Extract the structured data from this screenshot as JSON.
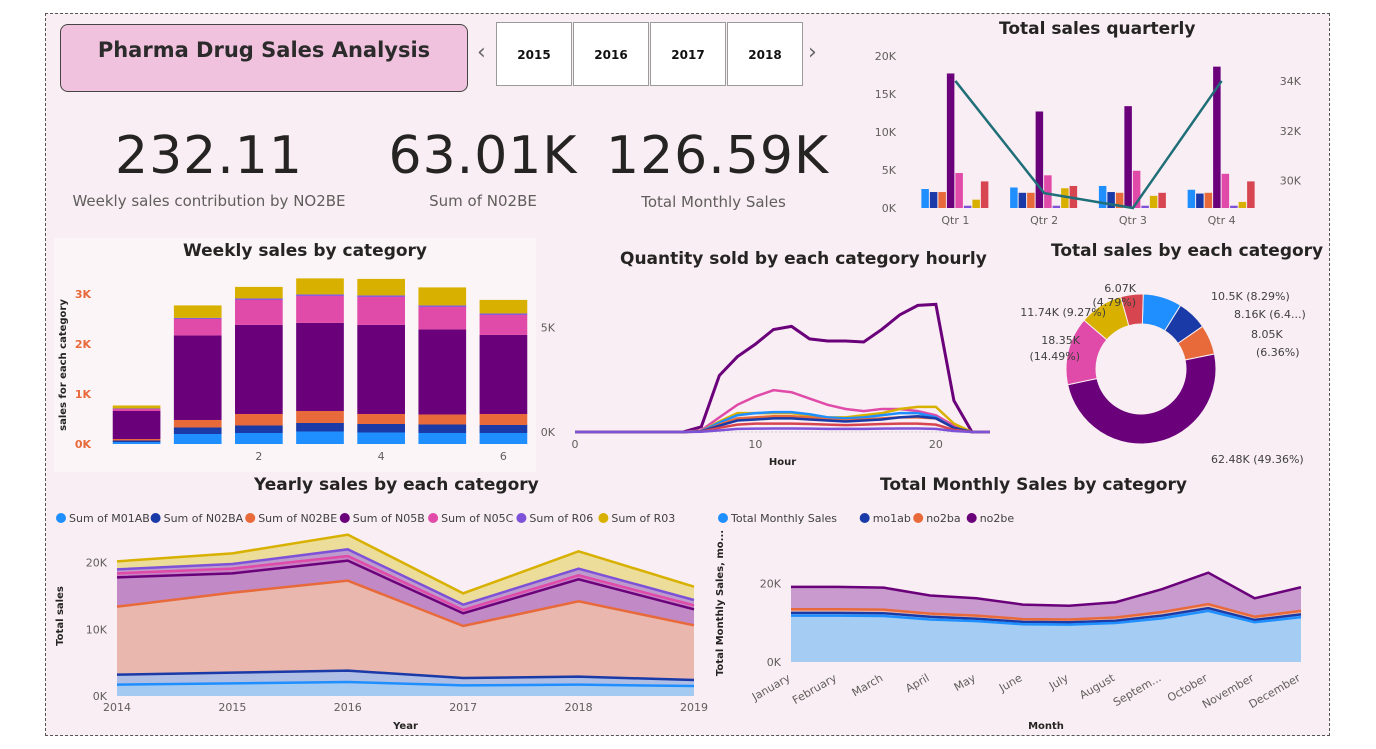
{
  "title": "Pharma Drug Sales Analysis",
  "slicer": {
    "years": [
      "2015",
      "2016",
      "2017",
      "2018"
    ],
    "prev": "‹",
    "next": "›"
  },
  "kpis": [
    {
      "value": "232.11",
      "label": "Weekly sales contribution by NO2BE"
    },
    {
      "value": "63.01K",
      "label": "Sum of N02BE"
    },
    {
      "value": "126.59K",
      "label": "Total Monthly Sales"
    }
  ],
  "colors": {
    "M01AB": "#1f8fff",
    "M01AE": "#1a3aa8",
    "N02BA": "#e86a3a",
    "N02BE": "#6b007b",
    "N05B": "#e04aa8",
    "N05C": "#7d52d8",
    "R03": "#d8b100",
    "R06": "#d64550",
    "teal": "#1f6e78"
  },
  "chart_data": [
    {
      "id": "quarterly",
      "type": "bar",
      "title": "Total sales quarterly",
      "categories": [
        "Qtr 1",
        "Qtr 2",
        "Qtr 3",
        "Qtr 4"
      ],
      "yticks": [
        "20K",
        "15K",
        "10K",
        "5K",
        "0K"
      ],
      "y2ticks": [
        "34K",
        "32K",
        "30K"
      ],
      "ylim": [
        0,
        20000
      ],
      "y2lim": [
        28900,
        35000
      ],
      "series": [
        {
          "color": "#1f8fff",
          "values": [
            2500,
            2700,
            2900,
            2400
          ]
        },
        {
          "color": "#1a3aa8",
          "values": [
            2100,
            2000,
            2100,
            1900
          ]
        },
        {
          "color": "#e86a3a",
          "values": [
            2100,
            2000,
            2000,
            2000
          ]
        },
        {
          "color": "#6b007b",
          "values": [
            17700,
            12700,
            13400,
            18600
          ]
        },
        {
          "color": "#e04aa8",
          "values": [
            4600,
            4300,
            4900,
            4500
          ]
        },
        {
          "color": "#7d52d8",
          "values": [
            300,
            300,
            300,
            300
          ]
        },
        {
          "color": "#d8b100",
          "values": [
            1100,
            2600,
            1600,
            800
          ]
        },
        {
          "color": "#d64550",
          "values": [
            3500,
            2900,
            2000,
            3500
          ]
        }
      ],
      "line": {
        "color": "#1f6e78",
        "values": [
          34000,
          29500,
          28900,
          34000
        ]
      }
    },
    {
      "id": "weekly",
      "type": "bar",
      "title": "Weekly sales by category",
      "ylabel": "sales for each category",
      "xticks": [
        "2",
        "4",
        "6"
      ],
      "yticks": [
        "3K",
        "2K",
        "1K",
        "0K"
      ],
      "ylim": [
        0,
        3000
      ],
      "x": [
        0,
        1,
        2,
        3,
        4,
        5,
        6
      ],
      "stacks": [
        {
          "color": "#1f8fff",
          "values": [
            40,
            200,
            220,
            250,
            230,
            220,
            220
          ]
        },
        {
          "color": "#1a3aa8",
          "values": [
            30,
            130,
            150,
            170,
            170,
            170,
            160
          ]
        },
        {
          "color": "#e86a3a",
          "values": [
            30,
            150,
            230,
            240,
            200,
            200,
            220
          ]
        },
        {
          "color": "#6b007b",
          "values": [
            560,
            1690,
            1780,
            1760,
            1780,
            1700,
            1580
          ]
        },
        {
          "color": "#e04aa8",
          "values": [
            40,
            330,
            500,
            540,
            560,
            450,
            400
          ]
        },
        {
          "color": "#7d52d8",
          "values": [
            10,
            20,
            30,
            30,
            30,
            30,
            30
          ]
        },
        {
          "color": "#d8b100",
          "values": [
            60,
            250,
            230,
            320,
            330,
            360,
            270
          ]
        }
      ]
    },
    {
      "id": "hourly",
      "type": "line",
      "title": "Quantity sold by each category hourly",
      "xlabel": "Hour",
      "xticks": [
        "0",
        "10",
        "20"
      ],
      "yticks": [
        "5K",
        "0K"
      ],
      "ylim": [
        0,
        6500
      ],
      "x": [
        0,
        1,
        2,
        3,
        4,
        5,
        6,
        7,
        8,
        9,
        10,
        11,
        12,
        13,
        14,
        15,
        16,
        17,
        18,
        19,
        20,
        21,
        22,
        23
      ],
      "series": [
        {
          "color": "#6b007b",
          "values": [
            0,
            0,
            0,
            0,
            0,
            0,
            0,
            250,
            2700,
            3600,
            4200,
            4900,
            5050,
            4450,
            4350,
            4350,
            4300,
            4900,
            5600,
            6050,
            6100,
            1500,
            0,
            0
          ]
        },
        {
          "color": "#e04aa8",
          "values": [
            0,
            0,
            0,
            0,
            0,
            0,
            0,
            80,
            700,
            1300,
            1700,
            2000,
            1900,
            1600,
            1300,
            1100,
            1000,
            1100,
            1100,
            1000,
            800,
            300,
            0,
            0
          ]
        },
        {
          "color": "#d8b100",
          "values": [
            0,
            0,
            0,
            0,
            0,
            0,
            0,
            50,
            500,
            900,
            900,
            900,
            900,
            800,
            700,
            700,
            800,
            900,
            1100,
            1200,
            1200,
            400,
            0,
            0
          ]
        },
        {
          "color": "#1f8fff",
          "values": [
            0,
            0,
            0,
            0,
            0,
            0,
            0,
            40,
            450,
            800,
            900,
            950,
            950,
            850,
            700,
            650,
            700,
            800,
            900,
            900,
            700,
            200,
            0,
            0
          ]
        },
        {
          "color": "#e86a3a",
          "values": [
            0,
            0,
            0,
            0,
            0,
            0,
            0,
            30,
            350,
            650,
            700,
            750,
            750,
            700,
            600,
            550,
            600,
            650,
            700,
            700,
            650,
            200,
            0,
            0
          ]
        },
        {
          "color": "#1a3aa8",
          "values": [
            0,
            0,
            0,
            0,
            0,
            0,
            0,
            30,
            300,
            550,
            600,
            650,
            650,
            600,
            550,
            500,
            550,
            600,
            700,
            750,
            650,
            200,
            0,
            0
          ]
        },
        {
          "color": "#d64550",
          "values": [
            0,
            0,
            0,
            0,
            0,
            0,
            0,
            20,
            200,
            350,
            400,
            400,
            400,
            380,
            350,
            330,
            350,
            380,
            400,
            400,
            350,
            100,
            0,
            0
          ]
        },
        {
          "color": "#7d52d8",
          "values": [
            0,
            0,
            0,
            0,
            0,
            0,
            0,
            10,
            80,
            150,
            160,
            170,
            170,
            160,
            150,
            150,
            150,
            160,
            170,
            170,
            150,
            50,
            0,
            0
          ]
        }
      ]
    },
    {
      "id": "donut",
      "type": "pie",
      "title": "Total sales by each category",
      "slices": [
        {
          "value": 10500,
          "color": "#1f8fff"
        },
        {
          "value": 8160,
          "color": "#1a3aa8"
        },
        {
          "value": 8050,
          "color": "#e86a3a"
        },
        {
          "value": 62480,
          "color": "#6b007b"
        },
        {
          "value": 18350,
          "color": "#e04aa8"
        },
        {
          "value": 11740,
          "color": "#d8b100"
        },
        {
          "value": 6070,
          "color": "#d64550"
        }
      ],
      "labels": [
        "10.5K (8.29%)",
        "8.16K (6.4...)",
        "8.05K",
        "(6.36%)",
        "62.48K (49.36%)",
        "18.35K",
        "(14.49%)",
        "11.74K (9.27%)",
        "6.07K",
        "(4.79%)"
      ]
    },
    {
      "id": "yearly",
      "type": "area",
      "title": "Yearly sales by each category",
      "ylabel": "Total sales",
      "xlabel": "Year",
      "x": [
        "2014",
        "2015",
        "2016",
        "2017",
        "2018",
        "2019"
      ],
      "yticks": [
        "20K",
        "10K",
        "0K"
      ],
      "ylim": [
        0,
        24000
      ],
      "legend": [
        "Sum of M01AB",
        "Sum of N02BA",
        "Sum of N02BE",
        "Sum of N05B",
        "Sum of N05C",
        "Sum of R06",
        "Sum of R03"
      ],
      "legend_colors": [
        "#1f8fff",
        "#1a3aa8",
        "#e86a3a",
        "#6b007b",
        "#e04aa8",
        "#7d52d8",
        "#d8b100"
      ],
      "series": [
        {
          "color": "#d8b100",
          "fill": "#ebd98a",
          "values": [
            20200,
            21400,
            24200,
            15400,
            21700,
            16400
          ]
        },
        {
          "color": "#7d52d8",
          "fill": "#b58fd6",
          "values": [
            19000,
            19800,
            22000,
            13700,
            19100,
            14400
          ]
        },
        {
          "color": "#e04aa8",
          "fill": "#c87dc0",
          "values": [
            18400,
            19100,
            21000,
            12900,
            18100,
            13600
          ]
        },
        {
          "color": "#6b007b",
          "fill": "#c08bc6",
          "values": [
            17800,
            18400,
            20300,
            12400,
            17500,
            13000
          ]
        },
        {
          "color": "#e86a3a",
          "fill": "#f0bfa8",
          "values": [
            13400,
            15500,
            17300,
            10500,
            14200,
            10600
          ]
        },
        {
          "color": "#1a3aa8",
          "fill": "#a5c0ee",
          "values": [
            3200,
            3500,
            3800,
            2700,
            2900,
            2400
          ]
        },
        {
          "color": "#1f8fff",
          "fill": "#a3ccf5",
          "values": [
            1700,
            1900,
            2100,
            1600,
            1700,
            1500
          ]
        }
      ]
    },
    {
      "id": "monthly",
      "type": "area",
      "title": "Total Monthly Sales by category",
      "ylabel": "Total Monthly Sales, mo...",
      "xlabel": "Month",
      "x": [
        "January",
        "February",
        "March",
        "April",
        "May",
        "June",
        "July",
        "August",
        "Septem...",
        "October",
        "November",
        "December"
      ],
      "yticks": [
        "20K",
        "0K"
      ],
      "ylim": [
        0,
        30000
      ],
      "legend": [
        "Total Monthly Sales",
        "mo1ab",
        "no2ba",
        "no2be"
      ],
      "legend_colors": [
        "#1f8fff",
        "#1a3aa8",
        "#e86a3a",
        "#6b007b"
      ],
      "series": [
        {
          "color": "#6b007b",
          "fill": "#c08bc6",
          "values": [
            19100,
            19100,
            18900,
            16900,
            16200,
            14600,
            14300,
            15200,
            18500,
            22700,
            16200,
            19000
          ]
        },
        {
          "color": "#e86a3a",
          "fill": "#f0bfa8",
          "values": [
            13400,
            13400,
            13300,
            12300,
            11800,
            10900,
            10800,
            11300,
            12700,
            14700,
            11500,
            13000
          ]
        },
        {
          "color": "#1a3aa8",
          "fill": "#a3ccf5",
          "values": [
            12500,
            12500,
            12400,
            11500,
            11000,
            10200,
            10100,
            10500,
            11800,
            13700,
            10700,
            12100
          ]
        },
        {
          "color": "#1f8fff",
          "fill": "#a3ccf5",
          "values": [
            11800,
            11800,
            11700,
            10800,
            10400,
            9600,
            9500,
            9900,
            11100,
            13000,
            10100,
            11400
          ]
        }
      ]
    }
  ]
}
